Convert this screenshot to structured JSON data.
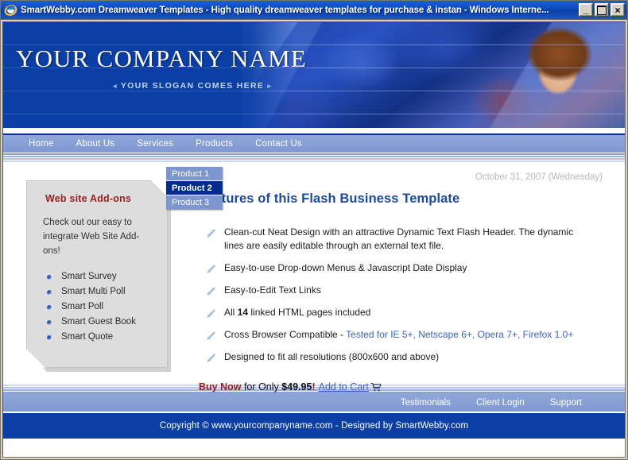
{
  "window": {
    "title": "SmartWebby.com Dreamweaver Templates - High quality dreamweaver templates for purchase & instan - Windows Interne...",
    "icon": "internet-explorer-icon",
    "minimize_label": "_",
    "maximize_label": "",
    "close_label": "×"
  },
  "banner": {
    "company_name": "YOUR COMPANY NAME",
    "slogan": "YOUR SLOGAN COMES HERE",
    "arrow_left": "◂",
    "arrow_right": "▸",
    "photo_alt": "keyboard-and-woman-banner"
  },
  "topnav": {
    "items": [
      {
        "label": "Home"
      },
      {
        "label": "About Us"
      },
      {
        "label": "Services"
      },
      {
        "label": "Products"
      },
      {
        "label": "Contact Us"
      }
    ]
  },
  "dropdown": {
    "parent": "Products",
    "items": [
      {
        "label": "Product 1",
        "selected": false
      },
      {
        "label": "Product 2",
        "selected": true
      },
      {
        "label": "Product 3",
        "selected": false
      }
    ]
  },
  "sidebar": {
    "title": "Web site Add-ons",
    "description": "Check out our easy to integrate Web Site Add-ons!",
    "items": [
      {
        "label": "Smart Survey"
      },
      {
        "label": "Smart Multi Poll"
      },
      {
        "label": "Smart Poll"
      },
      {
        "label": "Smart Guest Book"
      },
      {
        "label": "Smart Quote"
      }
    ]
  },
  "content": {
    "date": "October 31, 2007 (Wednesday)",
    "heading": "Features of this Flash Business Template",
    "features": [
      {
        "text": "Clean-cut Neat Design with an attractive Dynamic Text Flash Header. The dynamic lines are easily editable through an external text file."
      },
      {
        "text": "Easy-to-use Drop-down Menus & Javascript Date Display"
      },
      {
        "text": "Easy-to-Edit Text Links"
      },
      {
        "pre": "All ",
        "strong": "14",
        "post": " linked HTML pages included"
      },
      {
        "pre": "Cross Browser Compatible - ",
        "link": "Tested for IE 5+, Netscape 6+, Opera 7+, Firefox 1.0+"
      },
      {
        "text": "Designed to fit all resolutions (800x600 and above)"
      }
    ],
    "buy": {
      "buy_now": "Buy Now",
      "for_only": " for Only ",
      "price": "$49.95",
      "excl": "!",
      "cart_link": "Add to Cart",
      "cart_icon": "shopping-cart-icon"
    }
  },
  "footer": {
    "nav": [
      {
        "label": "Testimonials"
      },
      {
        "label": "Client Login"
      },
      {
        "label": "Support"
      }
    ],
    "copyright": "Copyright © www.yourcompanyname.com - Designed by SmartWebby.com"
  },
  "colors": {
    "brand_blue": "#0b3fa6",
    "nav_blue": "#8099d2",
    "heading_blue": "#1b4a9c",
    "accent_red": "#9a2020",
    "link_blue": "#3a63b8",
    "selected_menu": "#032c8f",
    "panel_gray": "#dddddd",
    "date_gray": "#b8b8b8"
  }
}
